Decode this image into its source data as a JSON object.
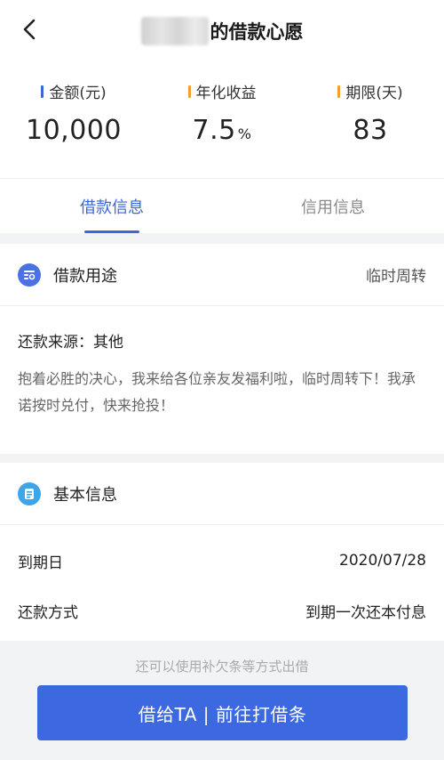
{
  "header": {
    "title_suffix": "的借款心愿"
  },
  "stats": [
    {
      "label": "金额(元)",
      "value": "10,000",
      "unit": "",
      "bar_color": "#3a66d8"
    },
    {
      "label": "年化收益",
      "value": "7.5",
      "unit": "%",
      "bar_color": "#f0a030"
    },
    {
      "label": "期限(天)",
      "value": "83",
      "unit": "",
      "bar_color": "#f0a030"
    }
  ],
  "tabs": [
    {
      "label": "借款信息",
      "active": true
    },
    {
      "label": "信用信息",
      "active": false
    }
  ],
  "purpose_card": {
    "title": "借款用途",
    "value": "临时周转",
    "source": "还款来源：其他",
    "description": "抱着必胜的决心，我来给各位亲友发福利啦，临时周转下！我承诺按时兑付，快来抢投！"
  },
  "basic_card": {
    "title": "基本信息",
    "rows": [
      {
        "label": "到期日",
        "value": "2020/07/28"
      },
      {
        "label": "还款方式",
        "value": "到期一次还本付息"
      }
    ]
  },
  "footer": {
    "hint": "还可以使用补欠条等方式出借",
    "cta_label": "借给TA | 前往打借条"
  },
  "colors": {
    "accent": "#3a66d8",
    "cta": "#3c68e0",
    "icon_blue": "#4a72e3",
    "icon_light_blue": "#3ea6e8"
  }
}
